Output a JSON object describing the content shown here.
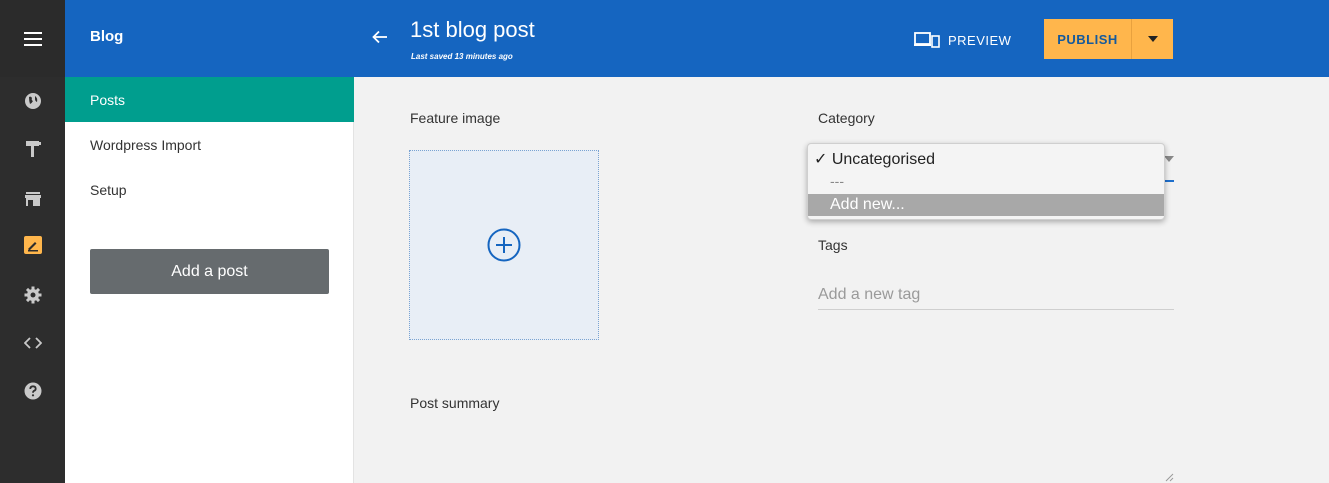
{
  "header": {
    "section_title": "Blog",
    "post_title": "1st blog post",
    "last_saved": "Last saved 13 minutes ago",
    "preview_label": "PREVIEW",
    "publish_label": "PUBLISH"
  },
  "rail": {
    "icons": [
      "globe-icon",
      "paint-roller-icon",
      "store-icon",
      "blog-edit-icon",
      "gear-icon",
      "code-icon",
      "help-icon"
    ]
  },
  "sidebar": {
    "items": [
      {
        "label": "Posts",
        "active": true
      },
      {
        "label": "Wordpress Import",
        "active": false
      },
      {
        "label": "Setup",
        "active": false
      }
    ],
    "add_button": "Add a post"
  },
  "main": {
    "feature_image_label": "Feature image",
    "category_label": "Category",
    "category_options": {
      "selected": "✓ Uncategorised",
      "separator": "---",
      "highlighted": "Add new..."
    },
    "tags_label": "Tags",
    "tags_placeholder": "Add a new tag",
    "summary_label": "Post summary"
  },
  "colors": {
    "header_blue": "#1565c0",
    "active_teal": "#009e8e",
    "publish_orange": "#ffb64c",
    "rail_dark": "#2d2d2d"
  }
}
